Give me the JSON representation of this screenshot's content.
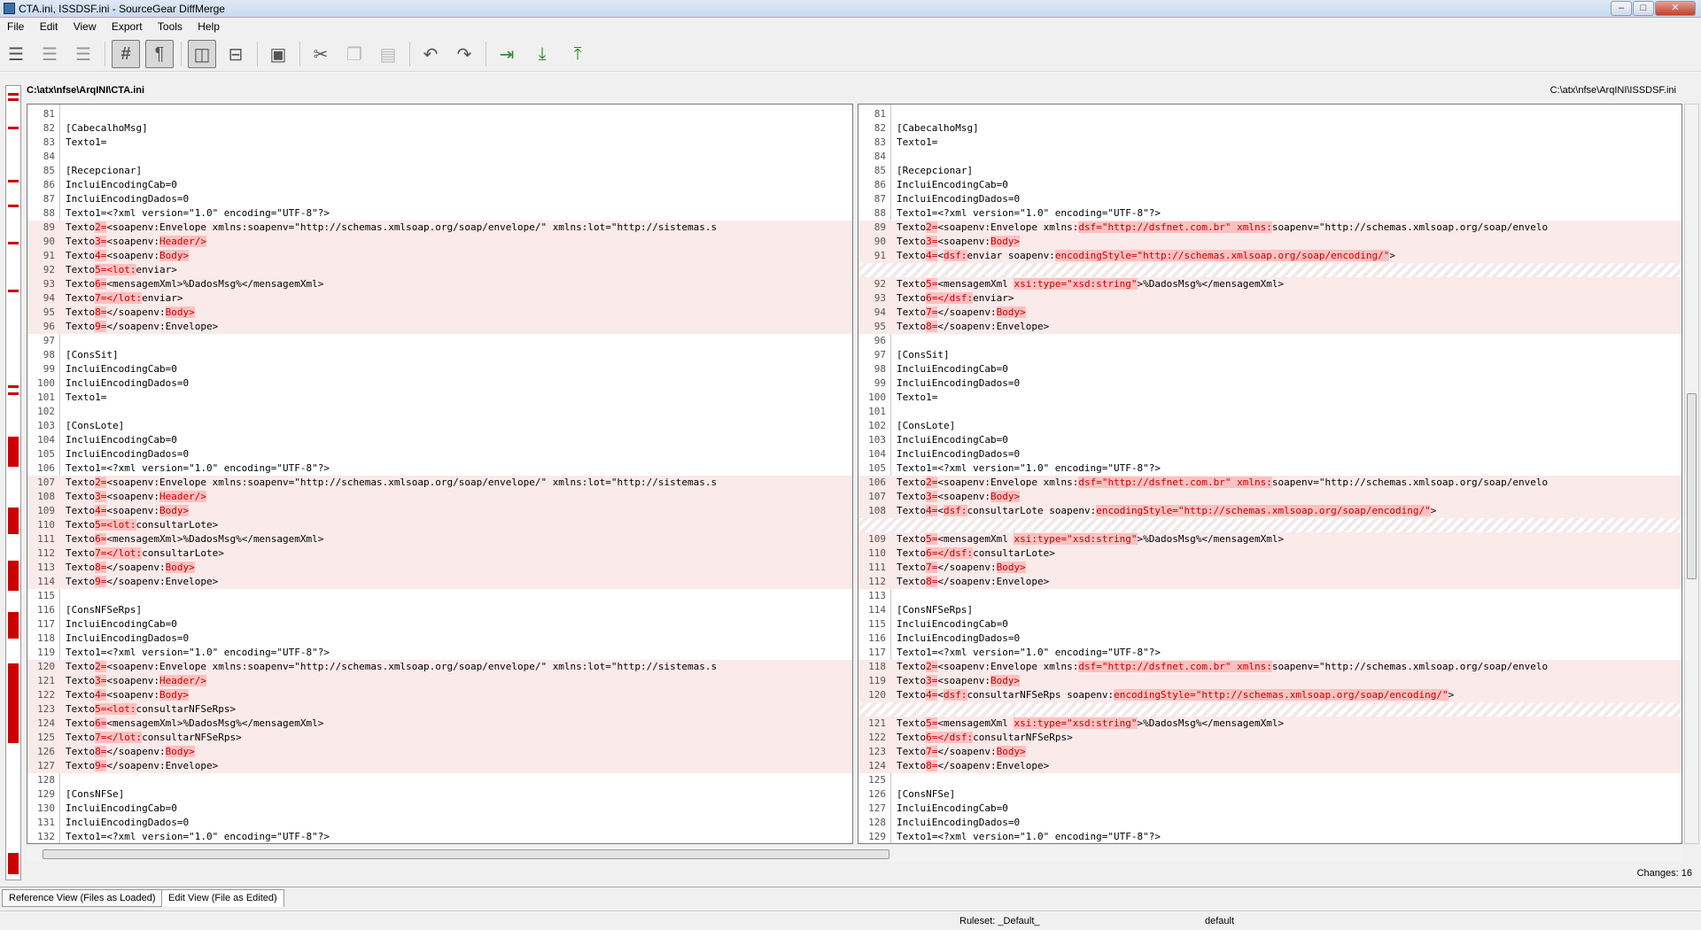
{
  "window": {
    "title": "CTA.ini, ISSDSF.ini - SourceGear DiffMerge",
    "min": "–",
    "max": "□",
    "close": "✕"
  },
  "menu": [
    "File",
    "Edit",
    "View",
    "Export",
    "Tools",
    "Help"
  ],
  "files": {
    "left": "C:\\atx\\nfse\\ArqINI\\CTA.ini",
    "right": "C:\\atx\\nfse\\ArqINI\\ISSDSF.ini"
  },
  "left": [
    {
      "n": "81",
      "t": "",
      "c": 0
    },
    {
      "n": "82",
      "t": "[CabecalhoMsg]",
      "c": 0
    },
    {
      "n": "83",
      "t": "Texto1=",
      "c": 0
    },
    {
      "n": "84",
      "t": "",
      "c": 0
    },
    {
      "n": "85",
      "t": "[Recepcionar]",
      "c": 0
    },
    {
      "n": "86",
      "t": "IncluiEncodingCab=0",
      "c": 0
    },
    {
      "n": "87",
      "t": "IncluiEncodingDados=0",
      "c": 0
    },
    {
      "n": "88",
      "t": "Texto1=<?xml version=\"1.0\" encoding=\"UTF-8\"?>",
      "c": 0
    },
    {
      "n": "89",
      "t": "Texto2=<soapenv:Envelope xmlns:soapenv=\"http://schemas.xmlsoap.org/soap/envelope/\" xmlns:lot=\"http://sistemas.s",
      "c": 1
    },
    {
      "n": "90",
      "t": "Texto3=<soapenv:Header/>",
      "c": 1
    },
    {
      "n": "91",
      "t": "Texto4=<soapenv:Body>",
      "c": 1
    },
    {
      "n": "92",
      "t": "Texto5=<lot:enviar>",
      "c": 1
    },
    {
      "n": "93",
      "t": "Texto6=<mensagemXml>%DadosMsg%</mensagemXml>",
      "c": 1
    },
    {
      "n": "94",
      "t": "Texto7=</lot:enviar>",
      "c": 1
    },
    {
      "n": "95",
      "t": "Texto8=</soapenv:Body>",
      "c": 1
    },
    {
      "n": "96",
      "t": "Texto9=</soapenv:Envelope>",
      "c": 1
    },
    {
      "n": "97",
      "t": "",
      "c": 0
    },
    {
      "n": "98",
      "t": "[ConsSit]",
      "c": 0
    },
    {
      "n": "99",
      "t": "IncluiEncodingCab=0",
      "c": 0
    },
    {
      "n": "100",
      "t": "IncluiEncodingDados=0",
      "c": 0
    },
    {
      "n": "101",
      "t": "Texto1=",
      "c": 0
    },
    {
      "n": "102",
      "t": "",
      "c": 0
    },
    {
      "n": "103",
      "t": "[ConsLote]",
      "c": 0
    },
    {
      "n": "104",
      "t": "IncluiEncodingCab=0",
      "c": 0
    },
    {
      "n": "105",
      "t": "IncluiEncodingDados=0",
      "c": 0
    },
    {
      "n": "106",
      "t": "Texto1=<?xml version=\"1.0\" encoding=\"UTF-8\"?>",
      "c": 0
    },
    {
      "n": "107",
      "t": "Texto2=<soapenv:Envelope xmlns:soapenv=\"http://schemas.xmlsoap.org/soap/envelope/\" xmlns:lot=\"http://sistemas.s",
      "c": 1
    },
    {
      "n": "108",
      "t": "Texto3=<soapenv:Header/>",
      "c": 1
    },
    {
      "n": "109",
      "t": "Texto4=<soapenv:Body>",
      "c": 1
    },
    {
      "n": "110",
      "t": "Texto5=<lot:consultarLote>",
      "c": 1
    },
    {
      "n": "111",
      "t": "Texto6=<mensagemXml>%DadosMsg%</mensagemXml>",
      "c": 1
    },
    {
      "n": "112",
      "t": "Texto7=</lot:consultarLote>",
      "c": 1
    },
    {
      "n": "113",
      "t": "Texto8=</soapenv:Body>",
      "c": 1
    },
    {
      "n": "114",
      "t": "Texto9=</soapenv:Envelope>",
      "c": 1
    },
    {
      "n": "115",
      "t": "",
      "c": 0
    },
    {
      "n": "116",
      "t": "[ConsNFSeRps]",
      "c": 0
    },
    {
      "n": "117",
      "t": "IncluiEncodingCab=0",
      "c": 0
    },
    {
      "n": "118",
      "t": "IncluiEncodingDados=0",
      "c": 0
    },
    {
      "n": "119",
      "t": "Texto1=<?xml version=\"1.0\" encoding=\"UTF-8\"?>",
      "c": 0
    },
    {
      "n": "120",
      "t": "Texto2=<soapenv:Envelope xmlns:soapenv=\"http://schemas.xmlsoap.org/soap/envelope/\" xmlns:lot=\"http://sistemas.s",
      "c": 1
    },
    {
      "n": "121",
      "t": "Texto3=<soapenv:Header/>",
      "c": 1
    },
    {
      "n": "122",
      "t": "Texto4=<soapenv:Body>",
      "c": 1
    },
    {
      "n": "123",
      "t": "Texto5=<lot:consultarNFSeRps>",
      "c": 1
    },
    {
      "n": "124",
      "t": "Texto6=<mensagemXml>%DadosMsg%</mensagemXml>",
      "c": 1
    },
    {
      "n": "125",
      "t": "Texto7=</lot:consultarNFSeRps>",
      "c": 1
    },
    {
      "n": "126",
      "t": "Texto8=</soapenv:Body>",
      "c": 1
    },
    {
      "n": "127",
      "t": "Texto9=</soapenv:Envelope>",
      "c": 1
    },
    {
      "n": "128",
      "t": "",
      "c": 0
    },
    {
      "n": "129",
      "t": "[ConsNFSe]",
      "c": 0
    },
    {
      "n": "130",
      "t": "IncluiEncodingCab=0",
      "c": 0
    },
    {
      "n": "131",
      "t": "IncluiEncodingDados=0",
      "c": 0
    },
    {
      "n": "132",
      "t": "Texto1=<?xml version=\"1.0\" encoding=\"UTF-8\"?>",
      "c": 0
    }
  ],
  "right": [
    {
      "n": "81",
      "t": "",
      "c": 0
    },
    {
      "n": "82",
      "t": "[CabecalhoMsg]",
      "c": 0
    },
    {
      "n": "83",
      "t": "Texto1=",
      "c": 0
    },
    {
      "n": "84",
      "t": "",
      "c": 0
    },
    {
      "n": "85",
      "t": "[Recepcionar]",
      "c": 0
    },
    {
      "n": "86",
      "t": "IncluiEncodingCab=0",
      "c": 0
    },
    {
      "n": "87",
      "t": "IncluiEncodingDados=0",
      "c": 0
    },
    {
      "n": "88",
      "t": "Texto1=<?xml version=\"1.0\" encoding=\"UTF-8\"?>",
      "c": 0
    },
    {
      "n": "89",
      "t": "Texto2=<soapenv:Envelope xmlns:dsf=\"http://dsfnet.com.br\" xmlns:soapenv=\"http://schemas.xmlsoap.org/soap/envelo",
      "c": 1
    },
    {
      "n": "90",
      "t": "Texto3=<soapenv:Body>",
      "c": 1
    },
    {
      "n": "91",
      "t": "Texto4=<dsf:enviar soapenv:encodingStyle=\"http://schemas.xmlsoap.org/soap/encoding/\">",
      "c": 1
    },
    {
      "n": "",
      "t": "",
      "c": 2
    },
    {
      "n": "92",
      "t": "Texto5=<mensagemXml xsi:type=\"xsd:string\">%DadosMsg%</mensagemXml>",
      "c": 1
    },
    {
      "n": "93",
      "t": "Texto6=</dsf:enviar>",
      "c": 1
    },
    {
      "n": "94",
      "t": "Texto7=</soapenv:Body>",
      "c": 1
    },
    {
      "n": "95",
      "t": "Texto8=</soapenv:Envelope>",
      "c": 1
    },
    {
      "n": "96",
      "t": "",
      "c": 0
    },
    {
      "n": "97",
      "t": "[ConsSit]",
      "c": 0
    },
    {
      "n": "98",
      "t": "IncluiEncodingCab=0",
      "c": 0
    },
    {
      "n": "99",
      "t": "IncluiEncodingDados=0",
      "c": 0
    },
    {
      "n": "100",
      "t": "Texto1=",
      "c": 0
    },
    {
      "n": "101",
      "t": "",
      "c": 0
    },
    {
      "n": "102",
      "t": "[ConsLote]",
      "c": 0
    },
    {
      "n": "103",
      "t": "IncluiEncodingCab=0",
      "c": 0
    },
    {
      "n": "104",
      "t": "IncluiEncodingDados=0",
      "c": 0
    },
    {
      "n": "105",
      "t": "Texto1=<?xml version=\"1.0\" encoding=\"UTF-8\"?>",
      "c": 0
    },
    {
      "n": "106",
      "t": "Texto2=<soapenv:Envelope xmlns:dsf=\"http://dsfnet.com.br\" xmlns:soapenv=\"http://schemas.xmlsoap.org/soap/envelo",
      "c": 1
    },
    {
      "n": "107",
      "t": "Texto3=<soapenv:Body>",
      "c": 1
    },
    {
      "n": "108",
      "t": "Texto4=<dsf:consultarLote soapenv:encodingStyle=\"http://schemas.xmlsoap.org/soap/encoding/\">",
      "c": 1
    },
    {
      "n": "",
      "t": "",
      "c": 2
    },
    {
      "n": "109",
      "t": "Texto5=<mensagemXml xsi:type=\"xsd:string\">%DadosMsg%</mensagemXml>",
      "c": 1
    },
    {
      "n": "110",
      "t": "Texto6=</dsf:consultarLote>",
      "c": 1
    },
    {
      "n": "111",
      "t": "Texto7=</soapenv:Body>",
      "c": 1
    },
    {
      "n": "112",
      "t": "Texto8=</soapenv:Envelope>",
      "c": 1
    },
    {
      "n": "113",
      "t": "",
      "c": 0
    },
    {
      "n": "114",
      "t": "[ConsNFSeRps]",
      "c": 0
    },
    {
      "n": "115",
      "t": "IncluiEncodingCab=0",
      "c": 0
    },
    {
      "n": "116",
      "t": "IncluiEncodingDados=0",
      "c": 0
    },
    {
      "n": "117",
      "t": "Texto1=<?xml version=\"1.0\" encoding=\"UTF-8\"?>",
      "c": 0
    },
    {
      "n": "118",
      "t": "Texto2=<soapenv:Envelope xmlns:dsf=\"http://dsfnet.com.br\" xmlns:soapenv=\"http://schemas.xmlsoap.org/soap/envelo",
      "c": 1
    },
    {
      "n": "119",
      "t": "Texto3=<soapenv:Body>",
      "c": 1
    },
    {
      "n": "120",
      "t": "Texto4=<dsf:consultarNFSeRps soapenv:encodingStyle=\"http://schemas.xmlsoap.org/soap/encoding/\">",
      "c": 1
    },
    {
      "n": "",
      "t": "",
      "c": 2
    },
    {
      "n": "121",
      "t": "Texto5=<mensagemXml xsi:type=\"xsd:string\">%DadosMsg%</mensagemXml>",
      "c": 1
    },
    {
      "n": "122",
      "t": "Texto6=</dsf:consultarNFSeRps>",
      "c": 1
    },
    {
      "n": "123",
      "t": "Texto7=</soapenv:Body>",
      "c": 1
    },
    {
      "n": "124",
      "t": "Texto8=</soapenv:Envelope>",
      "c": 1
    },
    {
      "n": "125",
      "t": "",
      "c": 0
    },
    {
      "n": "126",
      "t": "[ConsNFSe]",
      "c": 0
    },
    {
      "n": "127",
      "t": "IncluiEncodingCab=0",
      "c": 0
    },
    {
      "n": "128",
      "t": "IncluiEncodingDados=0",
      "c": 0
    },
    {
      "n": "129",
      "t": "Texto1=<?xml version=\"1.0\" encoding=\"UTF-8\"?>",
      "c": 0
    }
  ],
  "highlights": [
    "lot:",
    "Header/>",
    "Body>",
    "<lot:",
    "</lot:",
    "dsf=\"http://dsfnet.com.br\" xmlns:",
    "dsf:",
    "</dsf:",
    "encodingStyle=\"http://schemas.xmlsoap.org/soap/encoding/\"",
    "xsi:type=\"xsd:string\""
  ],
  "changes_label": "Changes: 16",
  "tabs": {
    "reference": "Reference View (Files as Loaded)",
    "edit": "Edit View (File as Edited)"
  },
  "status": {
    "ruleset": "Ruleset: _Default_",
    "default": "default"
  },
  "colors": {
    "changed_bg": "#fbeaea",
    "highlight": "#ffc0c0",
    "marker": "#cc0000"
  }
}
